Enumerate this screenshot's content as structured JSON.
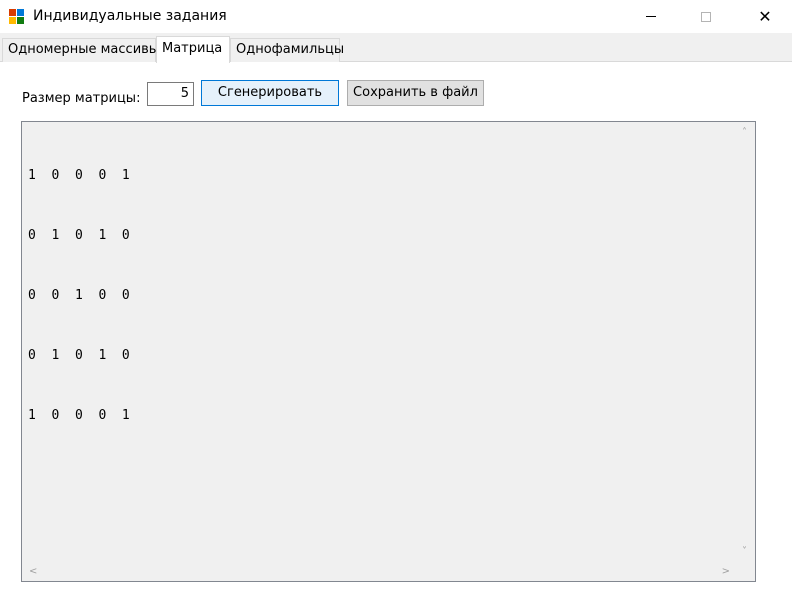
{
  "window": {
    "title": "Индивидуальные задания",
    "close_glyph": "✕"
  },
  "tabs": [
    {
      "label": "Одномерные массивы",
      "active": false
    },
    {
      "label": "Матрица",
      "active": true
    },
    {
      "label": "Однофамильцы",
      "active": false
    }
  ],
  "form": {
    "size_label": "Размер матрицы:",
    "size_value": "5",
    "generate_label": "Сгенерировать",
    "save_label": "Сохранить в файл"
  },
  "matrix": {
    "rows": [
      "1  0  0  0  1",
      "0  1  0  1  0",
      "0  0  1  0  0",
      "0  1  0  1  0",
      "1  0  0  0  1"
    ]
  },
  "scrollbars": {
    "up": "˄",
    "down": "˅",
    "left": "<",
    "right": ">"
  },
  "colors": {
    "primary_button_bg": "#e5f1fb",
    "primary_button_border": "#0078d7",
    "textbox_bg": "#f0f0f0"
  }
}
